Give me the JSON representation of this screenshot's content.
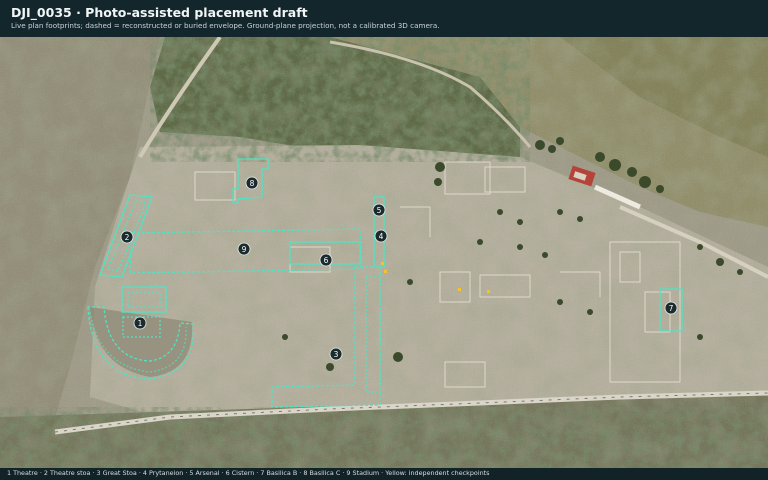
{
  "header": {
    "title": "DJI_0035 · Photo-assisted placement draft",
    "subtitle": "Live plan footprints; dashed = reconstructed or buried envelope. Ground-plane projection, not a calibrated 3D camera."
  },
  "footer": {
    "legend": "1 Theatre · 2 Theatre stoa · 3 Great Stoa · 4 Prytaneion · 5 Arsenal · 6 Cistern · 7 Basilica B · 8 Basilica C · 9 Stadium · Yellow: independent checkpoints"
  },
  "markers": [
    {
      "id": "1",
      "label": "1"
    },
    {
      "id": "2",
      "label": "2"
    },
    {
      "id": "3",
      "label": "3"
    },
    {
      "id": "4",
      "label": "4"
    },
    {
      "id": "5",
      "label": "5"
    },
    {
      "id": "6",
      "label": "6"
    },
    {
      "id": "7",
      "label": "7"
    },
    {
      "id": "8",
      "label": "8"
    },
    {
      "id": "9",
      "label": "9"
    }
  ],
  "colors": {
    "footprint": "#4fe3c3",
    "checkpoint": "#f2c230",
    "marker_fill": "#1c2b2d",
    "marker_text": "#ffffff"
  }
}
